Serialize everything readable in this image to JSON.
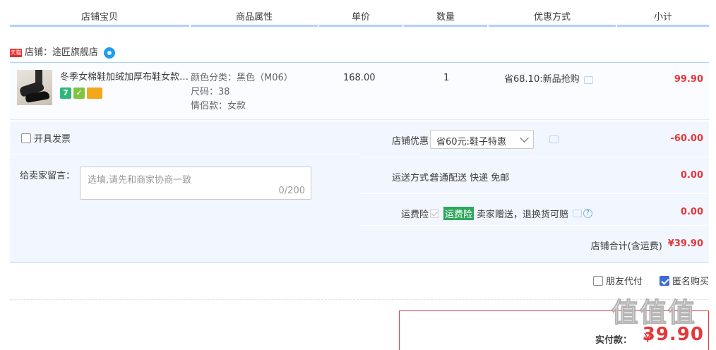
{
  "header": {
    "cols": [
      "店铺宝贝",
      "商品属性",
      "单价",
      "数量",
      "优惠方式",
      "小计"
    ]
  },
  "shop": {
    "badge": "天猫",
    "name": "店铺：途匠旗舰店"
  },
  "item": {
    "title": "冬季女棉鞋加绒加厚布鞋女款老北京布鞋",
    "icon_seven": "7",
    "icon_shield": "✓",
    "attrs": [
      "颜色分类：黑色（M06）",
      "尺码：38",
      "情侣款：女款"
    ],
    "price": "168.00",
    "qty": "1",
    "promo": "省68.10:新品抢购",
    "subtotal": "99.90"
  },
  "options": {
    "invoice_label": "开具发票",
    "message_label": "给卖家留言：",
    "message_placeholder": "选填,请先和商家协商一致",
    "message_count": "0/200",
    "coupon_label": "店铺优惠：",
    "coupon_value": "省60元:鞋子特惠",
    "coupon_amount": "-60.00",
    "shipping_label": "运送方式：",
    "shipping_value": "普通配送 快递 免邮",
    "shipping_amount": "0.00",
    "insurance_label": "运费险：",
    "insurance_badge": "运费险",
    "insurance_text": "卖家赠送，退换货可赔",
    "insurance_amount": "0.00",
    "store_total_label": "店铺合计(含运费)",
    "store_total_amount": "¥39.90"
  },
  "extras": {
    "friend_pay": "朋友代付",
    "anonymous": "匿名购买"
  },
  "pay": {
    "label": "实付款：",
    "yen": "¥",
    "amount": "39.90"
  },
  "watermark": "值值值",
  "colors": {
    "accent_blue": "#b2d1ff",
    "price_red": "#e4393c",
    "panel_bg": "#f2f7ff"
  },
  "icons": [
    "tmall-icon",
    "wangwang-icon",
    "chat-icon",
    "chevron-down-icon",
    "help-icon",
    "check-icon"
  ]
}
